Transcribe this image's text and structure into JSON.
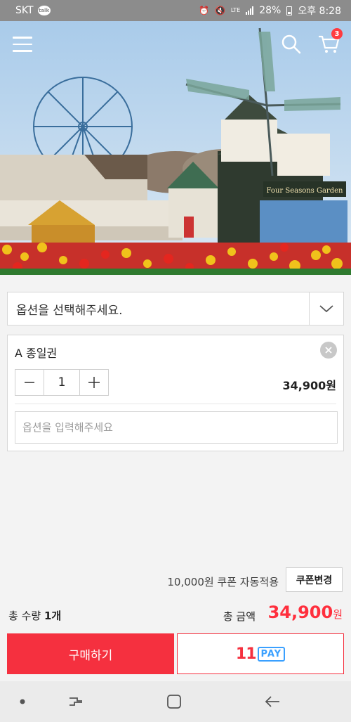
{
  "status_bar": {
    "carrier": "SKT",
    "talk_badge": "talk",
    "network": "LTE",
    "battery": "28%",
    "time": "오후 8:28"
  },
  "header": {
    "cart_count": "3",
    "icons": [
      "menu-icon",
      "search-icon",
      "cart-icon"
    ]
  },
  "hero": {
    "sign_text": "Four Seasons Garden"
  },
  "option_select": {
    "placeholder": "옵션을 선택해주세요."
  },
  "selected_item": {
    "name": "A 종일권",
    "quantity": "1",
    "price": "34,900원",
    "memo_placeholder": "옵션을 입력해주세요"
  },
  "coupon": {
    "text": "10,000원 쿠폰 자동적용",
    "button_label": "쿠폰변경"
  },
  "summary": {
    "qty_label": "총 수량",
    "qty_value": "1개",
    "total_label": "총 금액",
    "total_value": "34,900",
    "total_unit": "원"
  },
  "actions": {
    "buy_label": "구매하기",
    "pay_brand_num": "11",
    "pay_brand_text": "PAY"
  },
  "colors": {
    "accent": "#f5303f",
    "pay_blue": "#3aa0ff"
  }
}
